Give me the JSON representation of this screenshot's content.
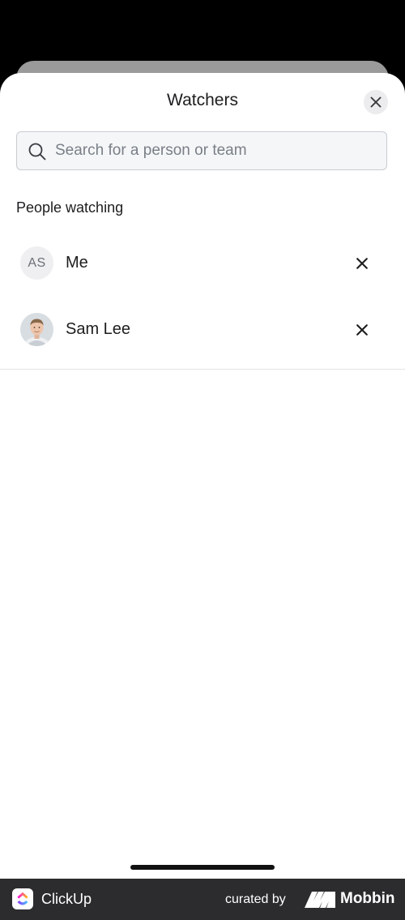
{
  "sheet": {
    "title": "Watchers",
    "close_icon": "close-icon"
  },
  "search": {
    "placeholder": "Search for a person or team",
    "value": "",
    "icon": "search-icon"
  },
  "watchers": {
    "section_label": "People watching",
    "people": [
      {
        "initials": "AS",
        "name": "Me",
        "avatar": "initials",
        "remove_icon": "close-icon"
      },
      {
        "initials": "",
        "name": "Sam Lee",
        "avatar": "photo",
        "remove_icon": "close-icon"
      }
    ]
  },
  "footer": {
    "app_name": "ClickUp",
    "curated_by": "curated by",
    "brand": "Mobbin"
  },
  "colors": {
    "sheet_background": "#ffffff",
    "backdrop": "#000000",
    "search_background": "#f4f6f8",
    "footer_background": "#2c2c2e",
    "text_primary": "#1d1d1f",
    "placeholder": "#7a7f87"
  }
}
